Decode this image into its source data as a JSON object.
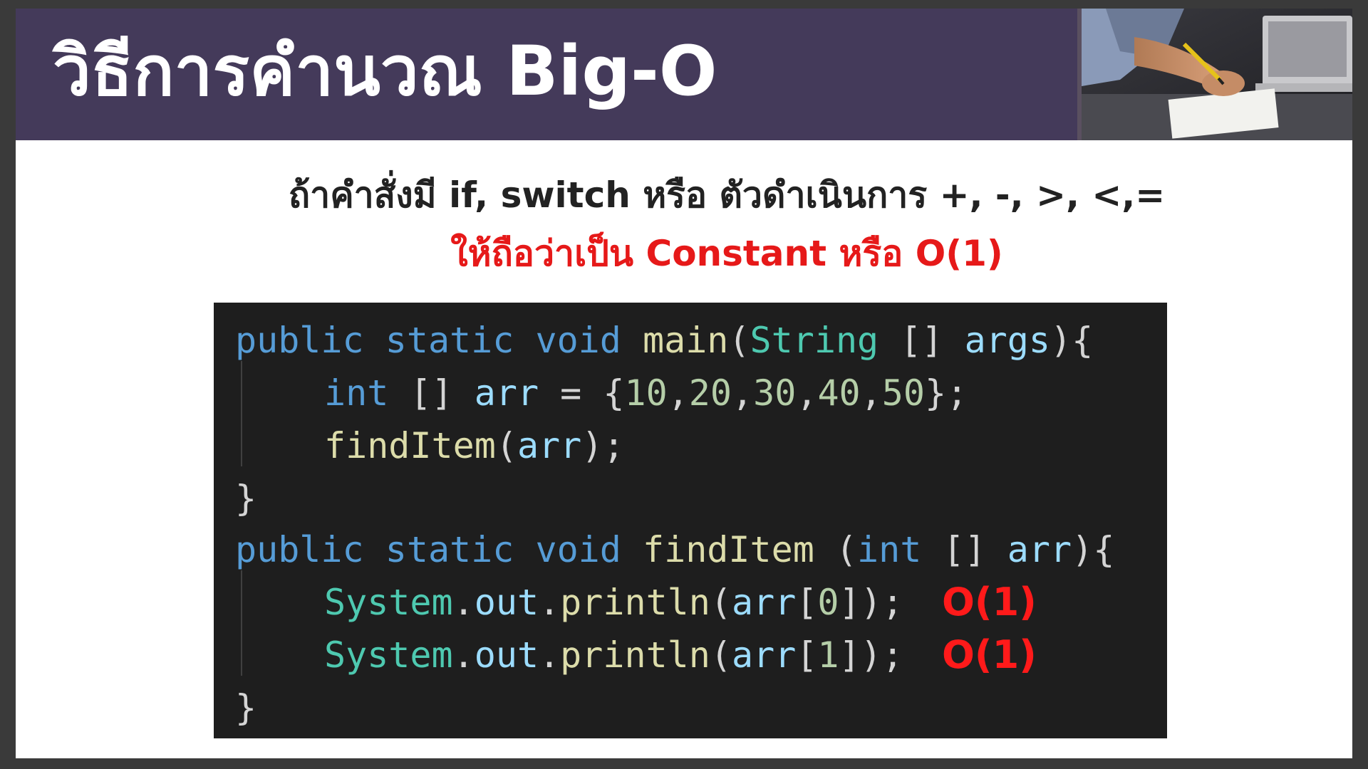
{
  "slide": {
    "title": "วิธีการคำนวณ Big-O",
    "subtitle_line1": "ถ้าคำสั่งมี if, switch หรือ ตัวดำเนินการ +, -, >, <,=",
    "subtitle_line2": "ให้ถือว่าเป็น Constant หรือ O(1)"
  },
  "code": {
    "line1": {
      "kw1": "public",
      "kw2": "static",
      "kw3": "void",
      "name": "main",
      "paren_open": "(",
      "type": "String",
      "brackets": " [] ",
      "param": "args",
      "close": "){"
    },
    "line2": {
      "kw": "int",
      "brackets": " [] ",
      "var": "arr",
      "eq": " = {",
      "n1": "10",
      "n2": "20",
      "n3": "30",
      "n4": "40",
      "n5": "50",
      "close": "};"
    },
    "line3": {
      "fn": "findItem",
      "open": "(",
      "arg": "arr",
      "close": ");"
    },
    "line4": {
      "brace": "}"
    },
    "line5": {
      "kw1": "public",
      "kw2": "static",
      "kw3": "void",
      "name": "findItem",
      "paren_open": " (",
      "type": "int",
      "brackets": " [] ",
      "param": "arr",
      "close": "){"
    },
    "line6": {
      "cls": "System",
      "dot1": ".",
      "field": "out",
      "dot2": ".",
      "fn": "println",
      "open": "(",
      "arg": "arr",
      "idx_open": "[",
      "idx": "0",
      "close": "]);"
    },
    "line7": {
      "cls": "System",
      "dot1": ".",
      "field": "out",
      "dot2": ".",
      "fn": "println",
      "open": "(",
      "arg": "arr",
      "idx_open": "[",
      "idx": "1",
      "close": "]);"
    },
    "line8": {
      "brace": "}"
    }
  },
  "annotations": {
    "line6_note": "O(1)",
    "line7_note": "O(1)"
  },
  "colors": {
    "title_bar": "#443a5a",
    "highlight_red": "#e61919",
    "code_bg": "#1e1e1e"
  },
  "icons": {
    "header_image": "person-writing-photo"
  }
}
